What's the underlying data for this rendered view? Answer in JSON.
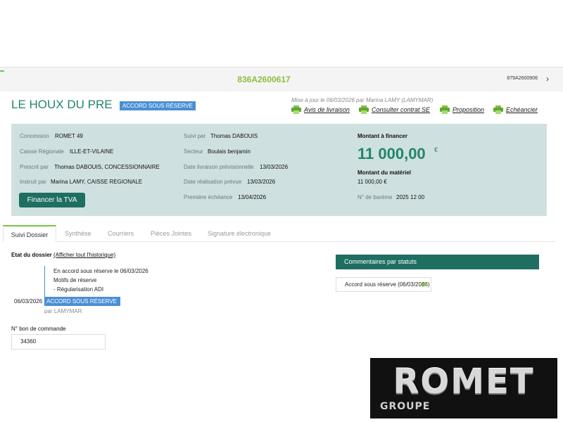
{
  "topbar": {
    "reference": "836A2600617",
    "next_reference": "879A2600906",
    "next_icon": "chevron-right-icon"
  },
  "header": {
    "title": "LE HOUX DU PRE",
    "status_badge": "ACCORD SOUS RÉSERVE",
    "updated": "Mise à jour le 06/03/2026 par Marina LAMY (LAMYMAR)",
    "actions": [
      {
        "label": "Avis de livraison",
        "icon": "printer-icon"
      },
      {
        "label": "Consulter contrat SE",
        "icon": "printer-icon"
      },
      {
        "label": "Proposition",
        "icon": "printer-icon"
      },
      {
        "label": "Echéancier",
        "icon": "printer-icon"
      }
    ]
  },
  "summary": {
    "concession": {
      "label": "Concession",
      "value": "ROMET 49"
    },
    "caisse": {
      "label": "Caisse Régionale",
      "value": "ILLE-ET-VILAINE"
    },
    "prescrit": {
      "label": "Prescrit par",
      "value": "Thomas DABOUIS, CONCESSIONNAIRE"
    },
    "instruit": {
      "label": "Instruit par",
      "value": "Marina LAMY, CAISSE REGIONALE"
    },
    "suivi": {
      "label": "Suivi par",
      "value": "Thomas DABOUIS"
    },
    "secteur": {
      "label": "Secteur",
      "value": "Boulais benjamin"
    },
    "date_livraison": {
      "label": "Date livraison prévisionnelle",
      "value": "13/03/2026"
    },
    "date_realisation": {
      "label": "Date réalisation prévue",
      "value": "13/03/2026"
    },
    "premiere_echeance": {
      "label": "Première échéance",
      "value": "13/04/2026"
    },
    "montant_financer": {
      "label": "Montant à financer",
      "value": "11 000,00",
      "currency": "€"
    },
    "montant_materiel": {
      "label": "Montant du matériel",
      "value": "11 000,00 €"
    },
    "bareme": {
      "label": "N° de barème",
      "value": "2025 12 00"
    },
    "tva_button": "Financer la TVA"
  },
  "tabs": [
    "Suivi Dossier",
    "Synthèse",
    "Courriers",
    "Pièces Jointes",
    "Signature électronique"
  ],
  "suivi": {
    "etat_label": "Etat du dossier",
    "history_link": "(Afficher tout l'historique)",
    "timeline": {
      "line1": "En accord sous réserve le 06/03/2026",
      "line2": "Motifs de réserve",
      "line3": "- Régularisation ADI",
      "date": "06/03/2026",
      "badge": "ACCORD SOUS RÉSERVE",
      "by": "par LAMYMAR"
    },
    "bon_commande": {
      "label": "N° bon de commande",
      "value": "34360"
    }
  },
  "comments": {
    "title": "Commentaires par statuts",
    "selected": "Accord sous réserve (06/03/2026)"
  },
  "logo": {
    "brand": "ROMET",
    "sub": "GROUPE"
  },
  "colors": {
    "brand_green": "#21856d",
    "accent_green": "#7cc242",
    "badge_blue": "#4a8fd6",
    "panel": "#cfe0e0",
    "dark_teal": "#1e6e61"
  }
}
